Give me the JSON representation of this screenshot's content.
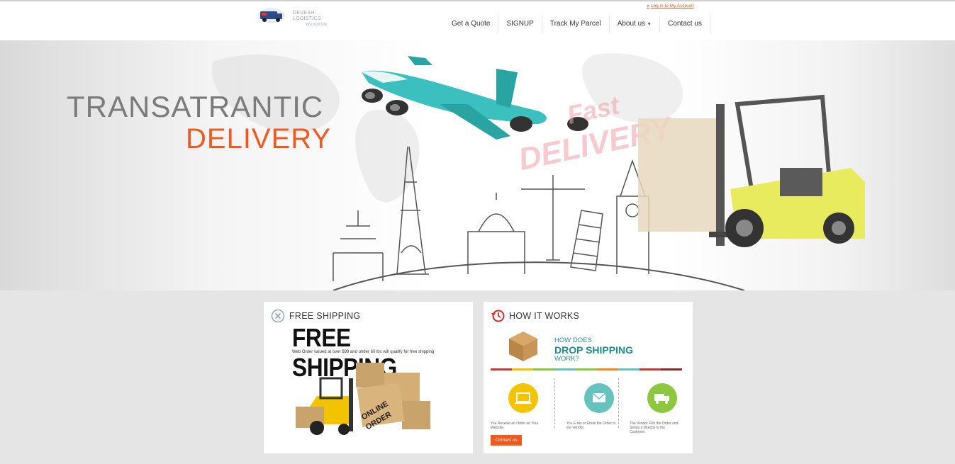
{
  "brand": {
    "name": "DEVESH LOGISTICS",
    "tagline": "Worldwide"
  },
  "login": {
    "label": "Log in to My Account"
  },
  "nav": {
    "items": [
      {
        "label": "Get a Quote"
      },
      {
        "label": "SIGNUP"
      },
      {
        "label": "Track My Parcel"
      },
      {
        "label": "About us"
      },
      {
        "label": "Contact us"
      }
    ]
  },
  "hero": {
    "title": "TRANSATRANTIC",
    "subtitle": "DELIVERY",
    "stamp_line1": "Fast",
    "stamp_line2": "DELIVERY",
    "accent_color": "#f05a1e"
  },
  "card_free": {
    "heading": "FREE SHIPPING",
    "banner": "FREE SHIPPING",
    "note": "Web Order valued at over $99 and under 60 lbs will qualify for free shipping",
    "box_label_1": "ONLINE",
    "box_label_2": "ORDER"
  },
  "card_how": {
    "heading": "HOW IT WORKS",
    "line1": "HOW DOES",
    "line2": "DROP SHIPPING",
    "line3": "WORK?",
    "steps": [
      {
        "text": "You Receive an Order on Your Website.",
        "color": "#f5c400",
        "icon": "laptop-icon"
      },
      {
        "text": "You E-fax or Email the Order to the Vendor.",
        "color": "#66c2bd",
        "icon": "envelope-icon"
      },
      {
        "text": "The Vendor Fills the Order and Sends it Directly to the Customer.",
        "color": "#8dc63f",
        "icon": "truck-icon"
      }
    ],
    "button": "Contact us"
  }
}
